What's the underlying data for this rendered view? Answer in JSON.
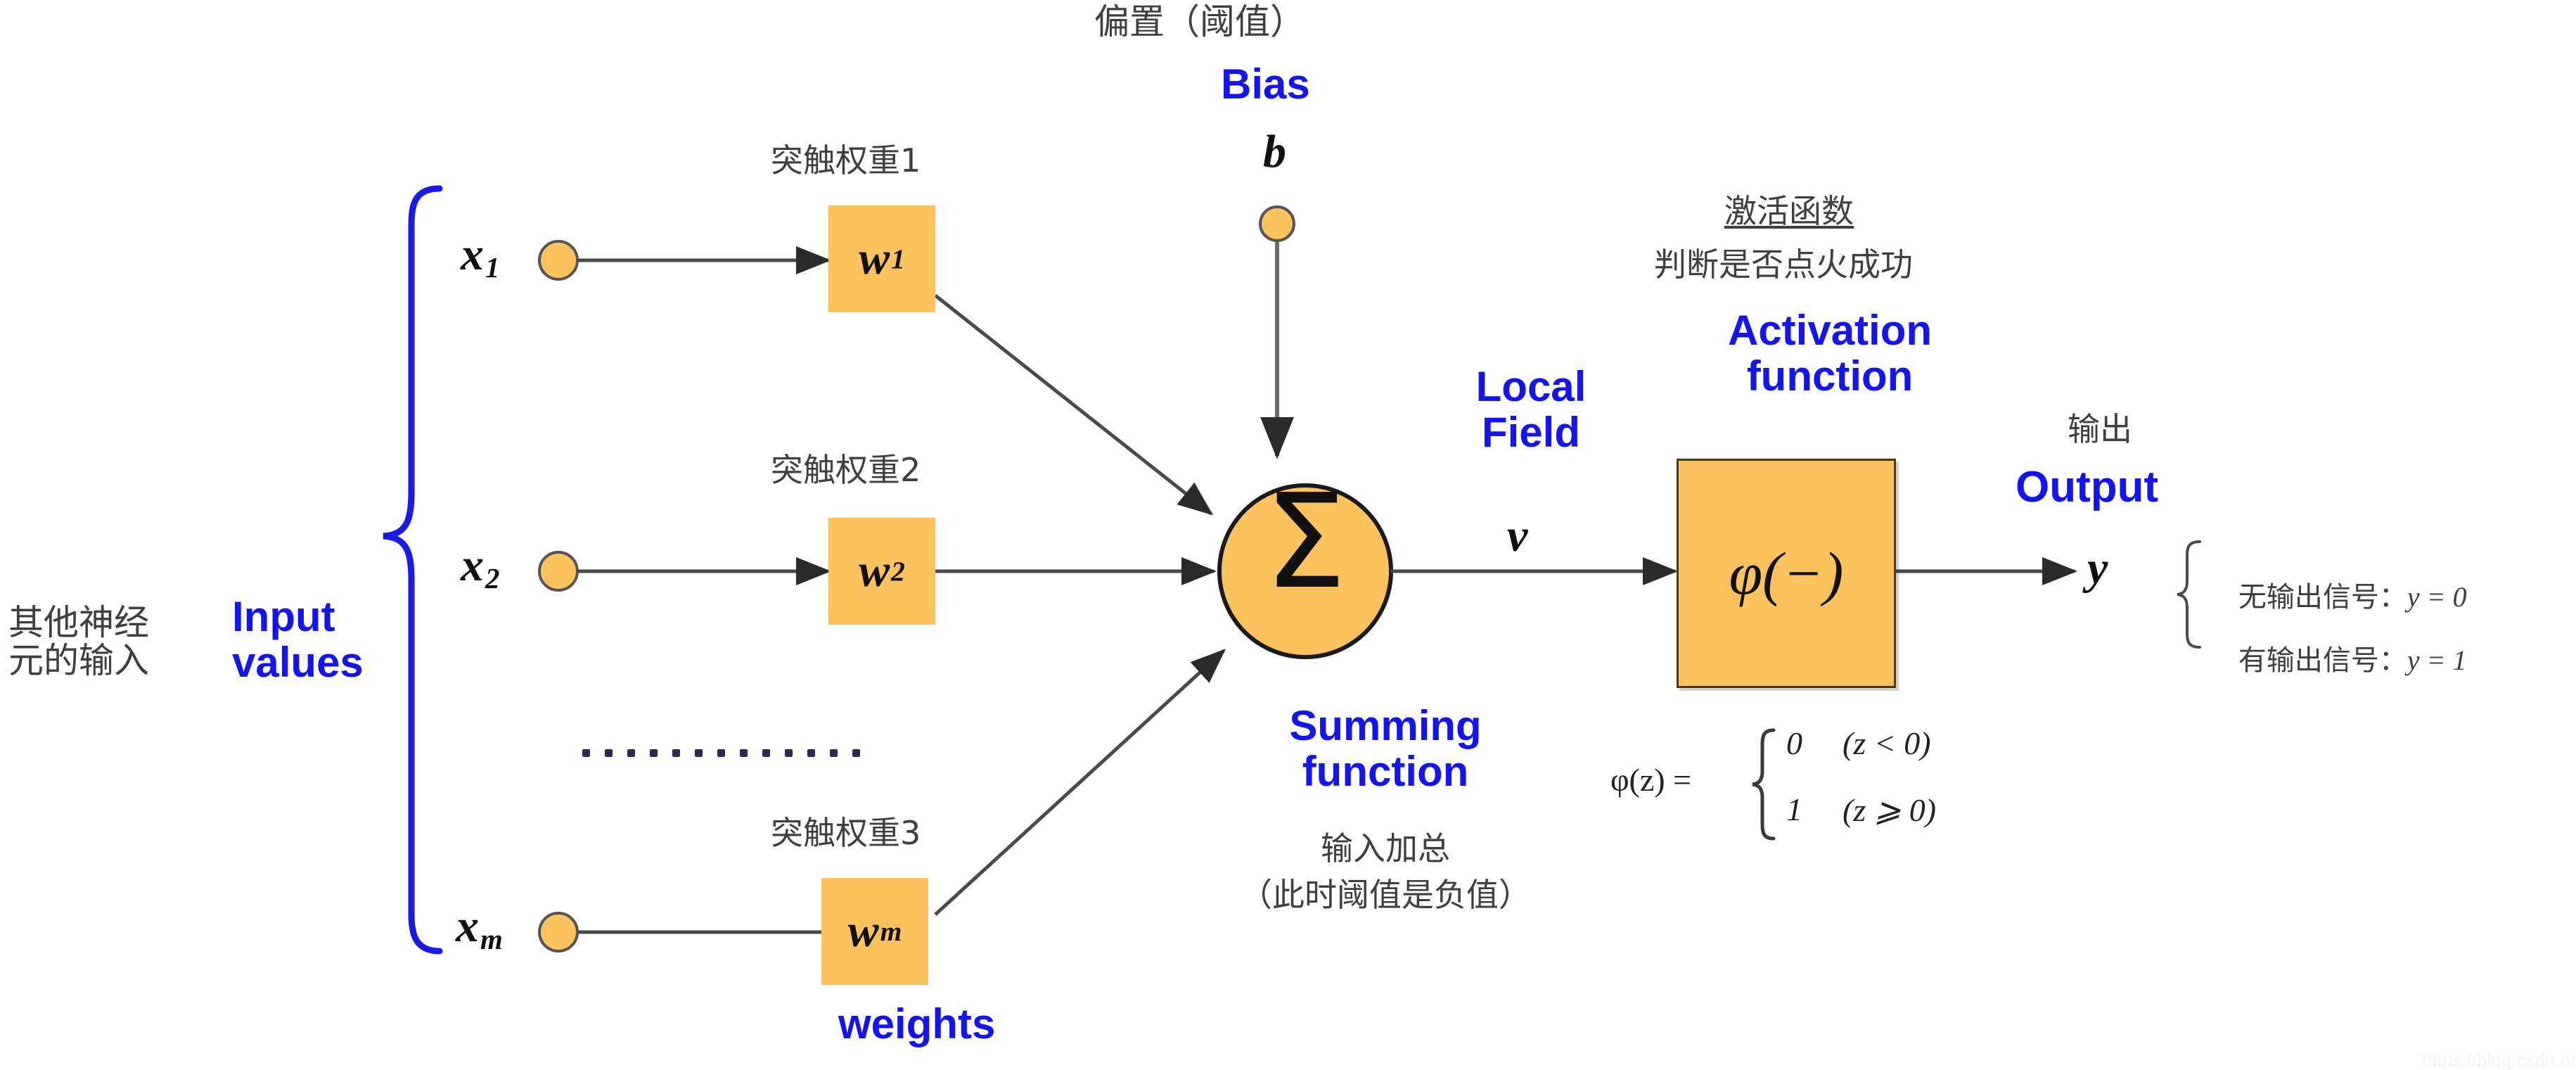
{
  "diagram": {
    "title_semantic": "artificial-neuron-model",
    "colors": {
      "accent_blue": "#1414f0",
      "node_fill": "#fbc25e",
      "brace_blue": "#1a1ae6",
      "text_gray": "#3f3f3f",
      "line": "#4a4a4a"
    }
  },
  "inputs": {
    "group_label_cn": "其他神经\n元的输入",
    "group_label_en": "Input\nvalues",
    "nodes": [
      {
        "symbol": "x",
        "subscript": "1"
      },
      {
        "symbol": "x",
        "subscript": "2"
      },
      {
        "symbol": "x",
        "subscript": "m"
      }
    ],
    "ellipsis_dot_count": 13
  },
  "weights": {
    "labels_cn": [
      "突触权重1",
      "突触权重2",
      "突触权重3"
    ],
    "label_en": "weights",
    "boxes": [
      {
        "symbol": "w",
        "subscript": "1"
      },
      {
        "symbol": "w",
        "subscript": "2"
      },
      {
        "symbol": "w",
        "subscript": "m"
      }
    ]
  },
  "bias": {
    "label_cn": "偏置（阈值）",
    "label_en": "Bias",
    "symbol": "b"
  },
  "summing": {
    "glyph": "Σ",
    "label_en": "Summing\nfunction",
    "label_cn_1": "输入加总",
    "label_cn_2": "（此时阈值是负值）"
  },
  "local_field": {
    "label_en": "Local\nField",
    "symbol": "v"
  },
  "activation": {
    "label_cn_title": "激活函数",
    "label_cn_sub": "判断是否点火成功",
    "label_en": "Activation\nfunction",
    "box_symbol": "φ(−)"
  },
  "output": {
    "label_cn": "输出",
    "label_en": "Output",
    "symbol": "y",
    "cases": [
      {
        "condition_cn": "无输出信号：",
        "value": "y = 0"
      },
      {
        "condition_cn": "有输出信号：",
        "value": "y = 1"
      }
    ]
  },
  "phi_formula": {
    "lhs": "φ(z) =",
    "rows": [
      {
        "value": "0",
        "condition": "(z < 0)"
      },
      {
        "value": "1",
        "condition": "(z ⩾ 0)"
      }
    ]
  },
  "watermark": {
    "text": "https://blog.csdn.net/linxiaoyin"
  }
}
